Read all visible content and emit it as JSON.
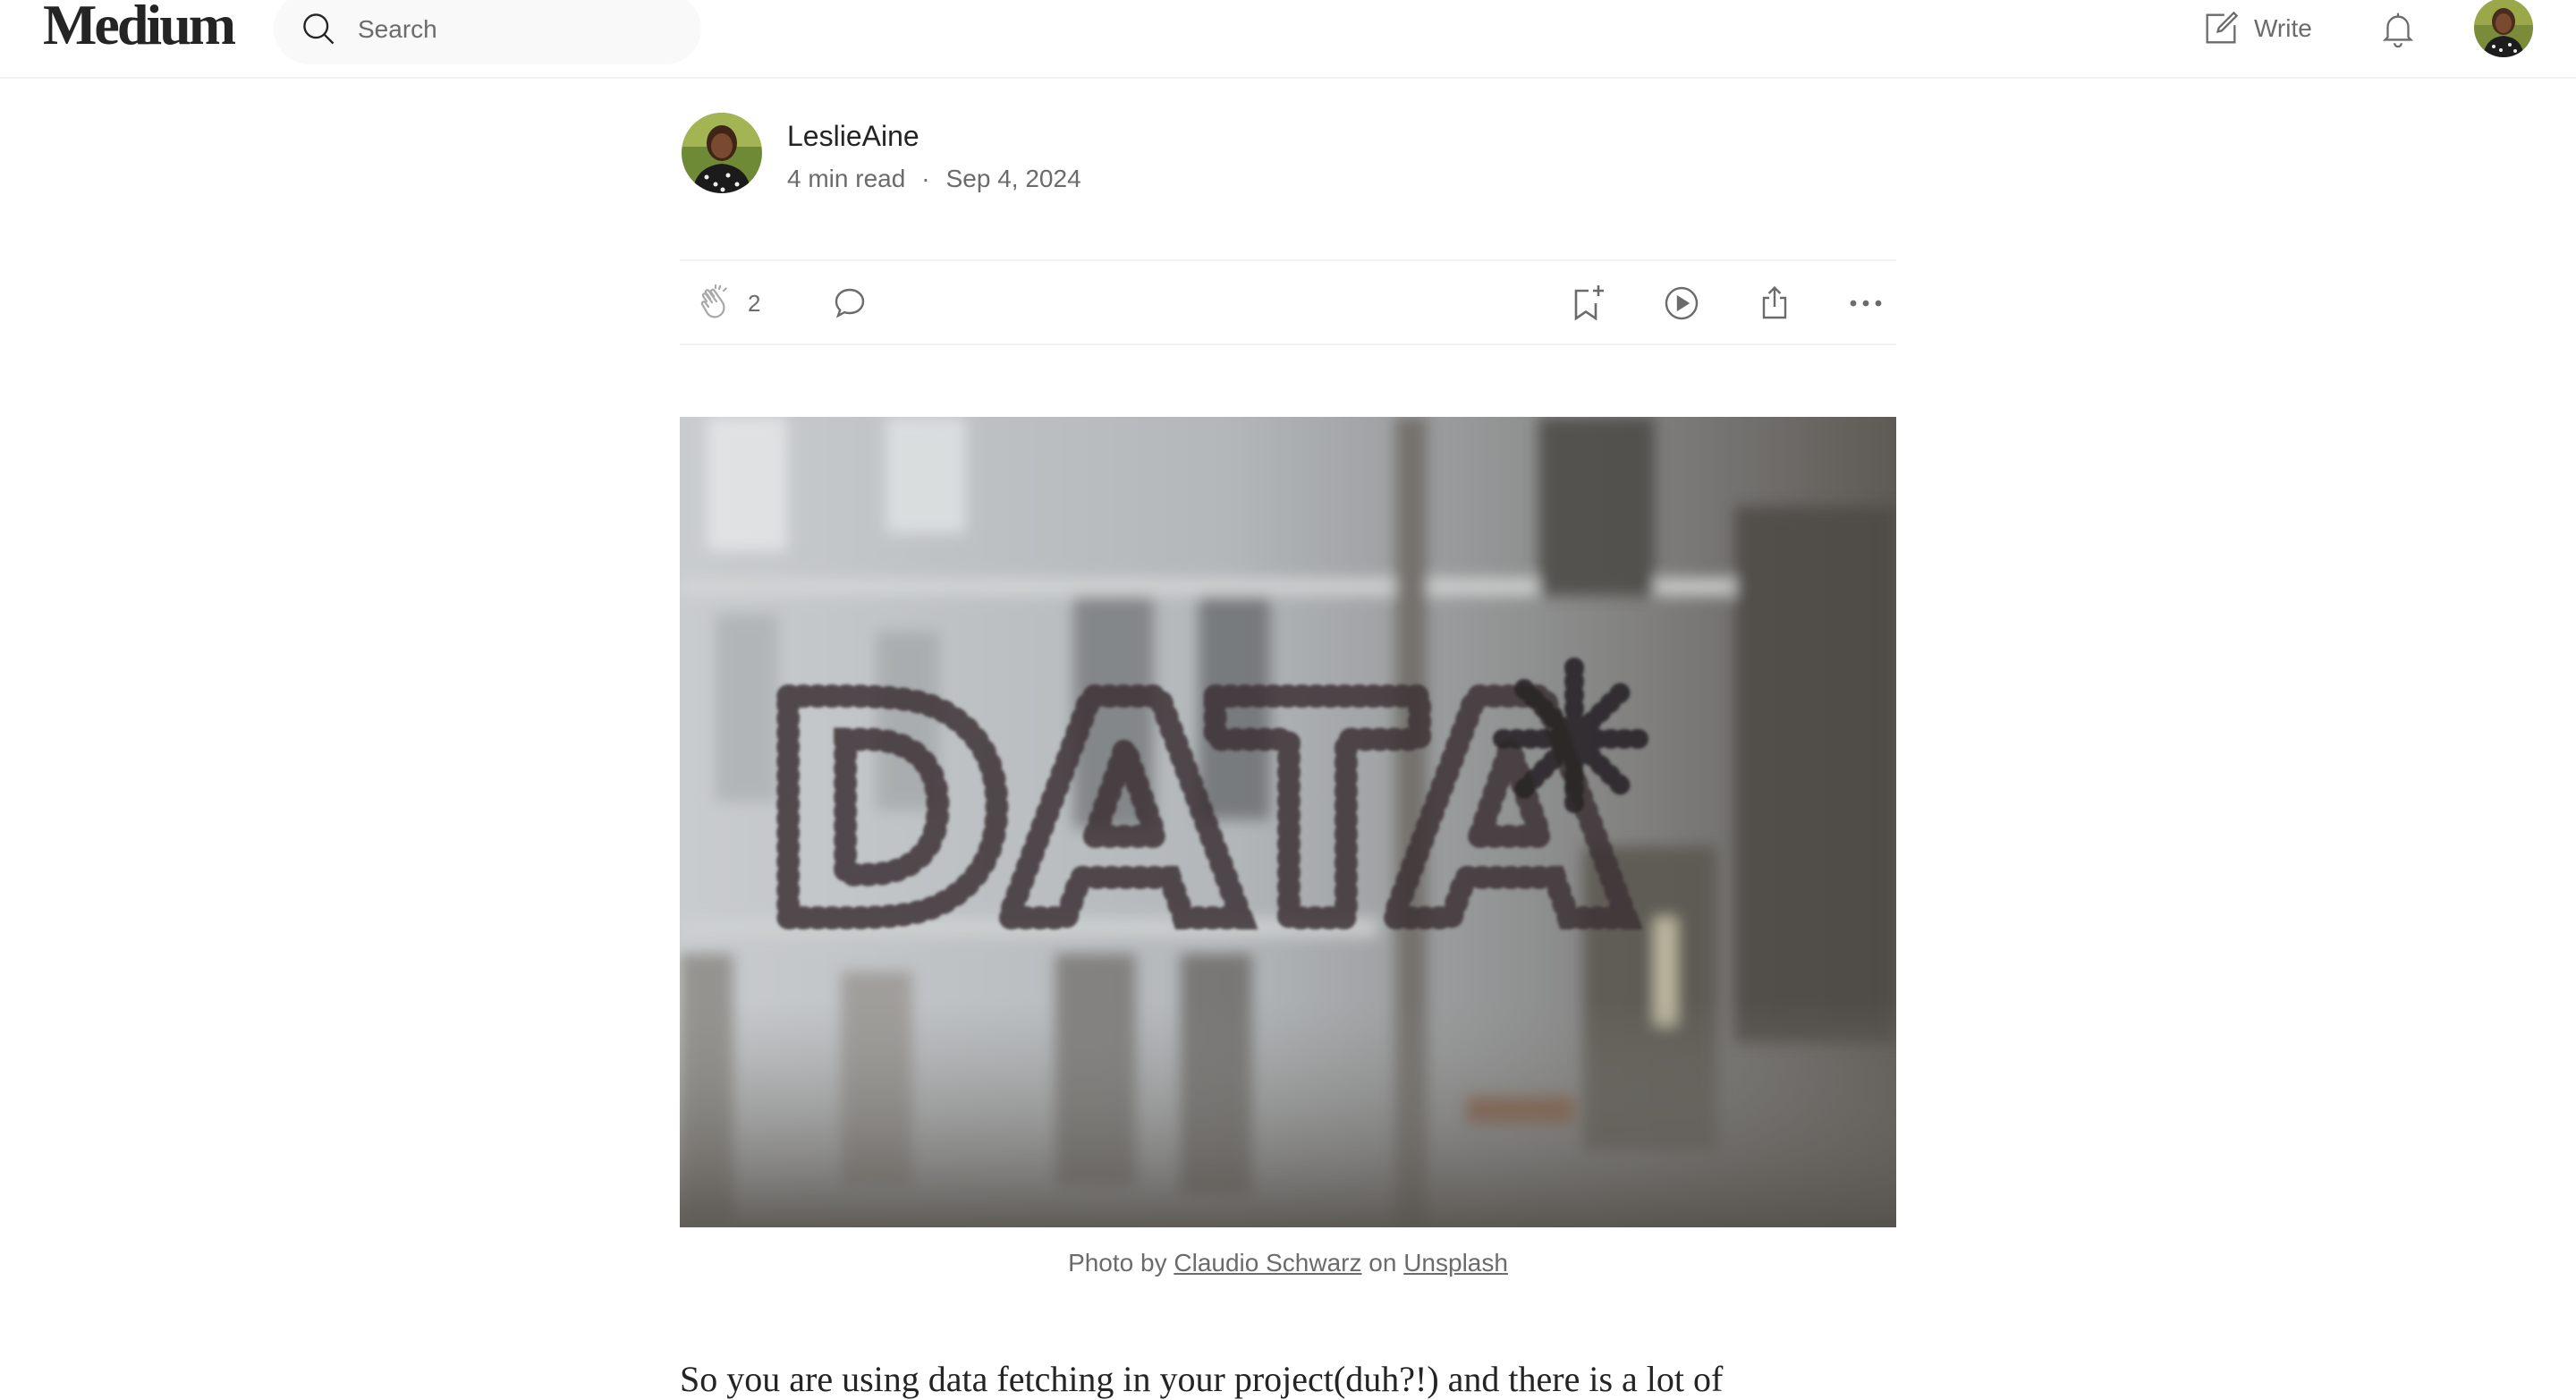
{
  "nav": {
    "logo": "Medium",
    "search_placeholder": "Search",
    "write_label": "Write"
  },
  "article": {
    "author": "LeslieAine",
    "read_time": "4 min read",
    "separator": "·",
    "date": "Sep 4, 2024",
    "clap_count": "2",
    "hero_alt": "Window with the word DATA written in dots",
    "hero_text": "DATA",
    "caption": {
      "prefix": "Photo by",
      "author_link": "Claudio Schwarz",
      "middle": "on",
      "source_link": "Unsplash"
    },
    "first_line": "So you are using data fetching in your project(duh?!) and there is a lot of"
  },
  "icons": {
    "search": "search-icon",
    "write": "write-icon",
    "notifications": "bell-icon",
    "clap": "clap-icon",
    "respond": "comment-icon",
    "save": "bookmark-add-icon",
    "listen": "play-circle-icon",
    "share": "share-icon",
    "more": "more-horizontal-icon"
  },
  "colors": {
    "text": "#242424",
    "muted": "#6b6b6b",
    "divider": "#f2f2f2",
    "search_bg": "#f9f9f9"
  }
}
